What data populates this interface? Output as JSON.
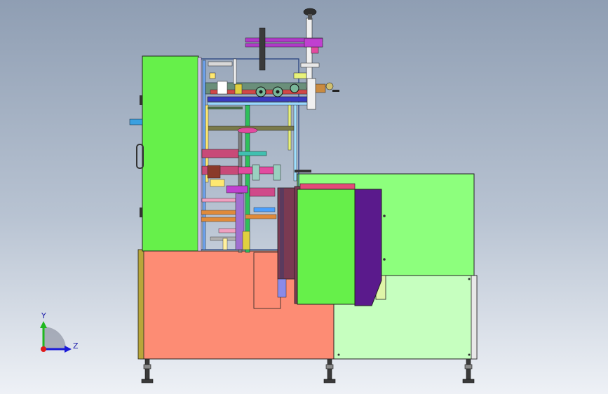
{
  "triad": {
    "y_label": "Y",
    "z_label": "Z"
  },
  "colors": {
    "background_top": "#8f9eb3",
    "background_bottom": "#eef1f6",
    "cabinet_green": "#66f04a",
    "lower_salmon": "#fd8c74",
    "lower_light_green": "#c6ffbf",
    "upper_light_green": "#8dff7d",
    "purple_panel": "#5a1a8c",
    "maroon_panel": "#7a3a52",
    "magenta_rod": "#b03ac8",
    "pink_parts": "#e34aa0",
    "khaki_plate": "#b8a63a",
    "hand_wheel": "#2f2f2f"
  }
}
